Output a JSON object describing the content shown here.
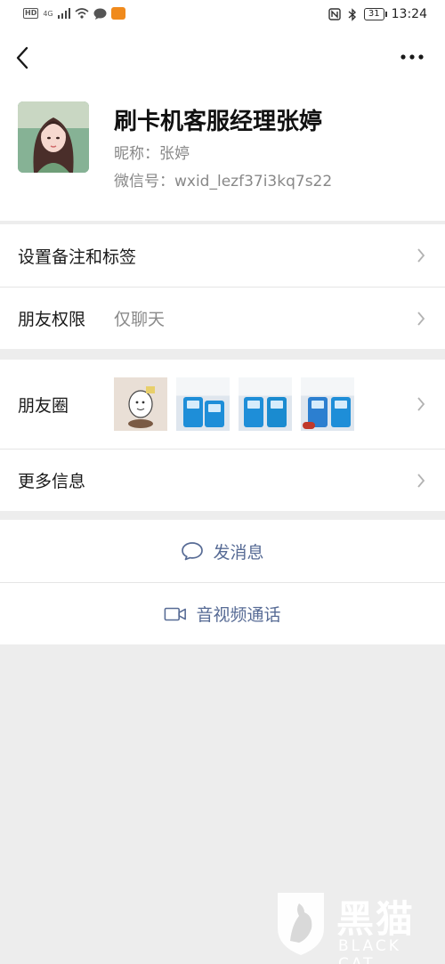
{
  "status_bar": {
    "hd": "HD",
    "network": "4G",
    "time": "13:24",
    "battery": "31"
  },
  "profile": {
    "name": "刷卡机客服经理张婷",
    "nickname": "昵称：张婷",
    "wechat_id": "微信号：wxid_lezf37i3kq7s22"
  },
  "settings": {
    "remark_label": "设置备注和标签",
    "permission_label": "朋友权限",
    "permission_value": "仅聊天"
  },
  "moments": {
    "label": "朋友圈",
    "more_info_label": "更多信息"
  },
  "actions": {
    "message_label": "发消息",
    "call_label": "音视频通话"
  },
  "watermark": {
    "title": "黑猫",
    "subtitle": "BLACK CAT"
  },
  "colors": {
    "link": "#576b95",
    "background": "#ededed"
  }
}
